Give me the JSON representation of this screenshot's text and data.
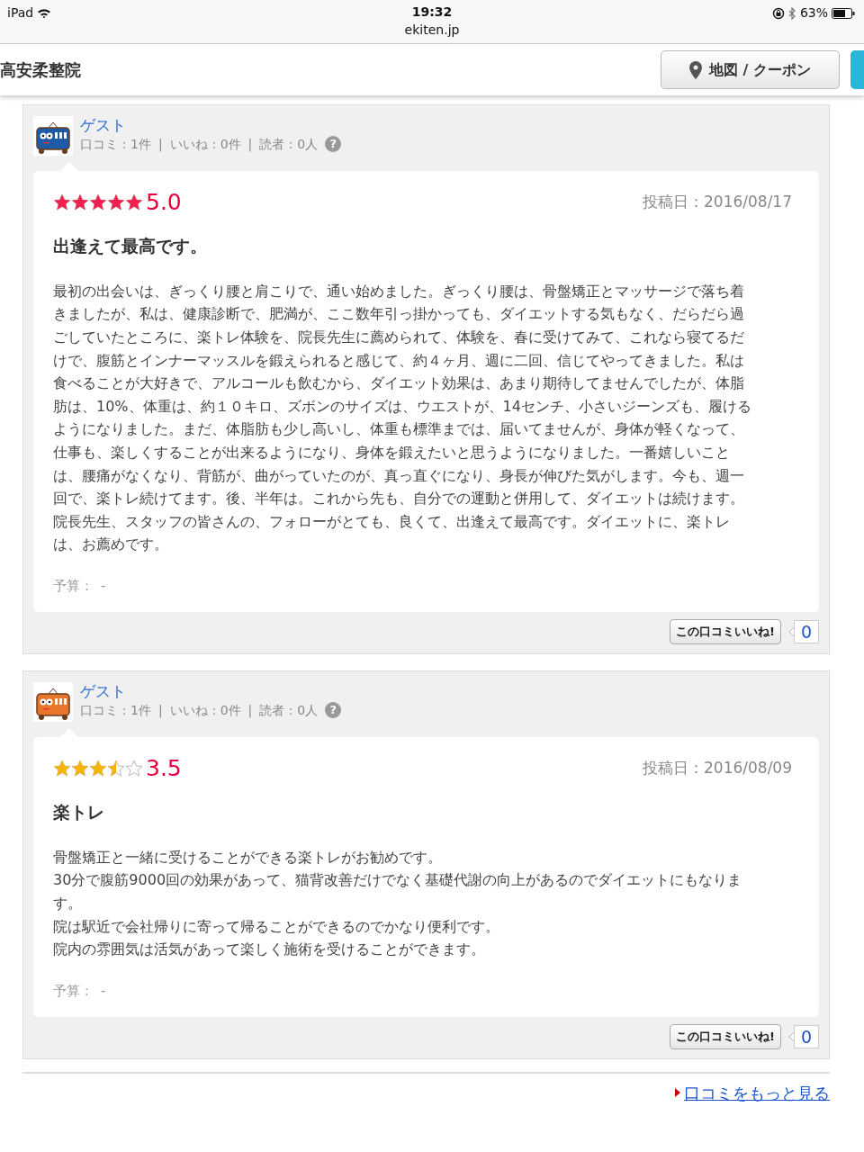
{
  "status_bar": {
    "device": "iPad",
    "time": "19:32",
    "url": "ekiten.jp",
    "battery": "63%"
  },
  "header": {
    "title": "高安柔整院",
    "map_button": "地図 / クーポン"
  },
  "reviews": [
    {
      "reviewer": {
        "name": "ゲスト",
        "color": "#1f5aa6",
        "stats": [
          "口コミ：1件",
          "|",
          "いいね：0件",
          "|",
          "読者：0人"
        ],
        "help": "?"
      },
      "stars": 5,
      "score": "5.0",
      "date": "投稿日：2016/08/17",
      "title": "出逢えて最高です。",
      "body": [
        "最初の出会いは、ぎっくり腰と肩こりで、通い始めました。ぎっくり腰は、骨盤矯正とマッサージで落ち着きましたが、私は、健康診断で、肥満が、ここ数年引っ掛かっても、ダイエットする気もなく、だらだら過ごしていたところに、楽トレ体験を、院長先生に薦められて、体験を、春に受けてみて、これなら寝てるだけで、腹筋とインナーマッスルを鍛えられると感じて、約４ヶ月、週に二回、信じてやってきました。私は食べることが大好きで、アルコールも飲むから、ダイエット効果は、あまり期待してませんでしたが、体脂肪は、10%、体重は、約１０キロ、ズボンのサイズは、ウエストが、14センチ、小さいジーンズも、履けるようになりました。まだ、体脂肪も少し高いし、体重も標準までは、届いてませんが、身体が軽くなって、仕事も、楽しくすることが出来るようになり、身体を鍛えたいと思うようになりました。一番嬉しいことは、腰痛がなくなり、背筋が、曲がっていたのが、真っ直ぐになり、身長が伸びた気がします。今も、週一回で、楽トレ続けてます。後、半年は。これから先も、自分での運動と併用して、ダイエットは続けます。院長先生、スタッフの皆さんの、フォローがとても、良くて、出逢えて最高です。ダイエットに、楽トレは、お薦めです。"
      ],
      "budget_label": "予算：",
      "budget": "-",
      "like_button": "この口コミいいね!",
      "like_count": "0"
    },
    {
      "reviewer": {
        "name": "ゲスト",
        "color": "#e8762a",
        "stats": [
          "口コミ：1件",
          "|",
          "いいね：0件",
          "|",
          "読者：0人"
        ],
        "help": "?"
      },
      "stars": 3.5,
      "score": "3.5",
      "date": "投稿日：2016/08/09",
      "title": "楽トレ",
      "body": [
        "骨盤矯正と一緒に受けることができる楽トレがお勧めです。",
        "30分で腹筋9000回の効果があって、猫背改善だけでなく基礎代謝の向上があるのでダイエットにもなります。",
        "院は駅近で会社帰りに寄って帰ることができるのでかなり便利です。",
        "院内の雰囲気は活気があって楽しく施術を受けることができます。"
      ],
      "budget_label": "予算：",
      "budget": "-",
      "like_button": "この口コミいいね!",
      "like_count": "0"
    }
  ],
  "more_link": "口コミをもっと見る"
}
